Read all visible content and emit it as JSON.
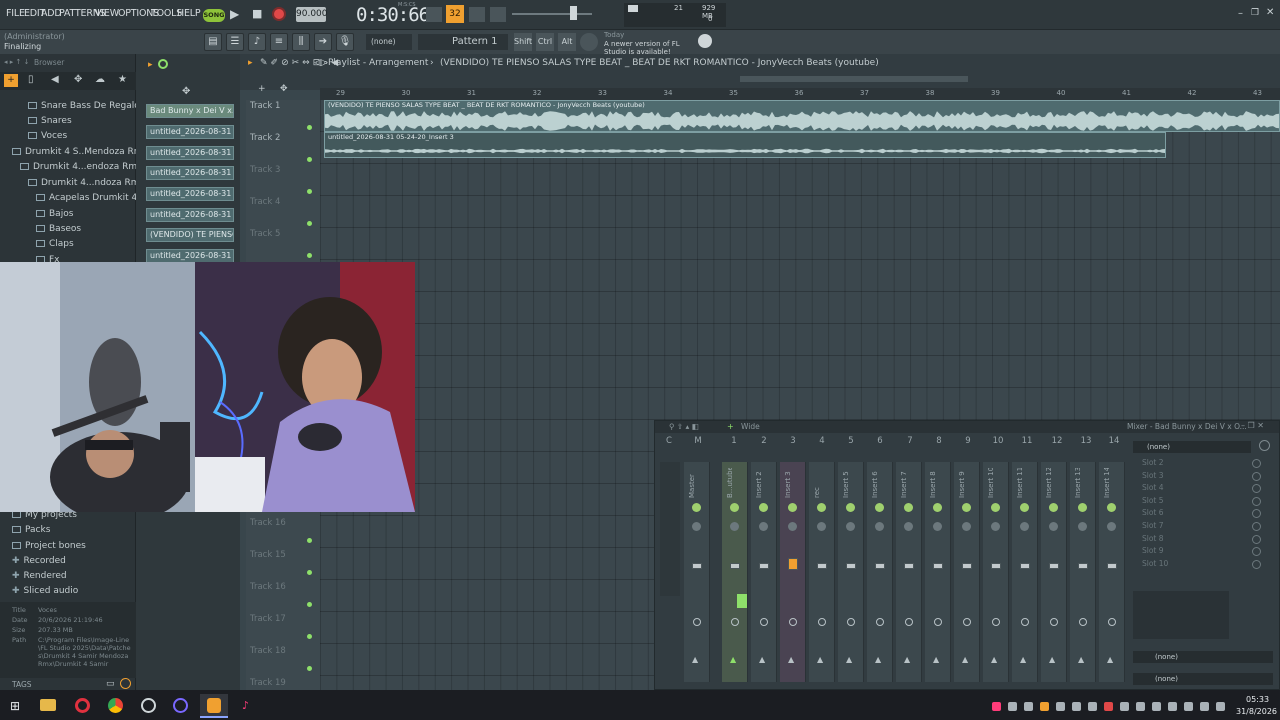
{
  "menu": {
    "items": [
      "FILE",
      "EDIT",
      "ADD",
      "PATTERNS",
      "VIEW",
      "OPTIONS",
      "TOOLS",
      "HELP"
    ],
    "song_badge": "SONG",
    "tempo": "90.000",
    "time": "0:30:66",
    "time_label": "M:S:CS",
    "snap_value": "32",
    "cpu": "21",
    "memory": "929 MB",
    "voices": "0"
  },
  "hint": {
    "line1": "(Administrator)",
    "line2": "Finalizing"
  },
  "toolbar": {
    "snap": "(none)",
    "pattern": "Pattern 1",
    "shift": "Shift",
    "ctrl": "Ctrl",
    "alt": "Alt",
    "news_day": "Today",
    "news_text": "A newer version of FL Studio is available!"
  },
  "browser": {
    "title": "Browser",
    "items": [
      {
        "label": "Snare Bass De Regalo",
        "indent": 2
      },
      {
        "label": "Snares",
        "indent": 2
      },
      {
        "label": "Voces",
        "indent": 2
      },
      {
        "label": "Drumkit 4 S..Mendoza Rmx",
        "indent": 0
      },
      {
        "label": "Drumkit 4...endoza Rmx",
        "indent": 1
      },
      {
        "label": "Drumkit 4...ndoza Rmx",
        "indent": 2
      },
      {
        "label": "Acapelas Drumkit 4",
        "indent": 3
      },
      {
        "label": "Bajos",
        "indent": 3
      },
      {
        "label": "Baseos",
        "indent": 3
      },
      {
        "label": "Claps",
        "indent": 3
      },
      {
        "label": "Fx",
        "indent": 3
      }
    ],
    "lower_items": [
      "My projects",
      "Packs",
      "Project bones",
      "Recorded",
      "Rendered",
      "Sliced audio"
    ],
    "info": {
      "title_label": "Title",
      "title_value": "Voces",
      "date_label": "Date",
      "date_value": "20/6/2026 21:19:46",
      "size_label": "Size",
      "size_value": "207.33 MB",
      "path_label": "Path",
      "path_value": "C:\\Program Files\\Image-Line\\FL Studio 2025\\Data\\Patches\\Drumkit 4 Samir Mendoza Rmx\\Drumkit 4 Samir"
    },
    "tags": "TAGS"
  },
  "clips": [
    "Bad Bunny x Dei V x...",
    "untitled_2026-08-31 04-...",
    "untitled_2026-08-31 05-...",
    "untitled_2026-08-31 05-...",
    "untitled_2026-08-31 05-...",
    "untitled_2026-08-31 05-...",
    "(VENDIDO) TE PIENSO...",
    "untitled_2026-08-31 05-..."
  ],
  "playlist": {
    "title": "Playlist - Arrangement",
    "song": "(VENDIDO) TE PIENSO SALAS TYPE BEAT _ BEAT DE RKT ROMANTICO - JonyVecch Beats (youtube)",
    "ruler": [
      "29",
      "30",
      "31",
      "32",
      "33",
      "34",
      "35",
      "36",
      "37",
      "38",
      "39",
      "40",
      "41",
      "42",
      "43"
    ],
    "tracks_top": [
      "Track 1",
      "Track 2",
      "Track 3",
      "Track 4",
      "Track 5"
    ],
    "tracks_bottom": [
      "Track 16",
      "Track 15",
      "Track 16",
      "Track 17",
      "Track 18",
      "Track 19"
    ],
    "clip1_label": "(VENDIDO) TE PIENSO SALAS TYPE BEAT _ BEAT DE RKT ROMANTICO - JonyVecch Beats (youtube)",
    "clip2_label": "untitled_2026-08-31 05-24-20_Insert 3"
  },
  "mixer": {
    "title": "Mixer - Bad Bunny x Dei V x O...",
    "view": "Wide",
    "header_labels": [
      "C",
      "M",
      "1",
      "2",
      "3",
      "4",
      "5",
      "6",
      "7",
      "8",
      "9",
      "10",
      "11",
      "12",
      "13",
      "14"
    ],
    "strip_names": [
      "Master",
      "B...utube)",
      "Insert 2",
      "Insert 3",
      "rec",
      "Insert 5",
      "Insert 6",
      "Insert 7",
      "Insert 8",
      "Insert 9",
      "Insert 10",
      "Insert 11",
      "Insert 12",
      "Insert 13",
      "Insert 14"
    ],
    "input": "(none)",
    "slots": [
      "Slot 2",
      "Slot 3",
      "Slot 4",
      "Slot 5",
      "Slot 6",
      "Slot 7",
      "Slot 8",
      "Slot 9",
      "Slot 10"
    ],
    "out1": "(none)",
    "out2": "(none)"
  },
  "taskbar": {
    "time": "05:33",
    "date": "31/8/2026"
  },
  "colors": {
    "accent_green": "#8ee06a",
    "accent_orange": "#f0a030",
    "clip_body": "#4f6b6f"
  }
}
